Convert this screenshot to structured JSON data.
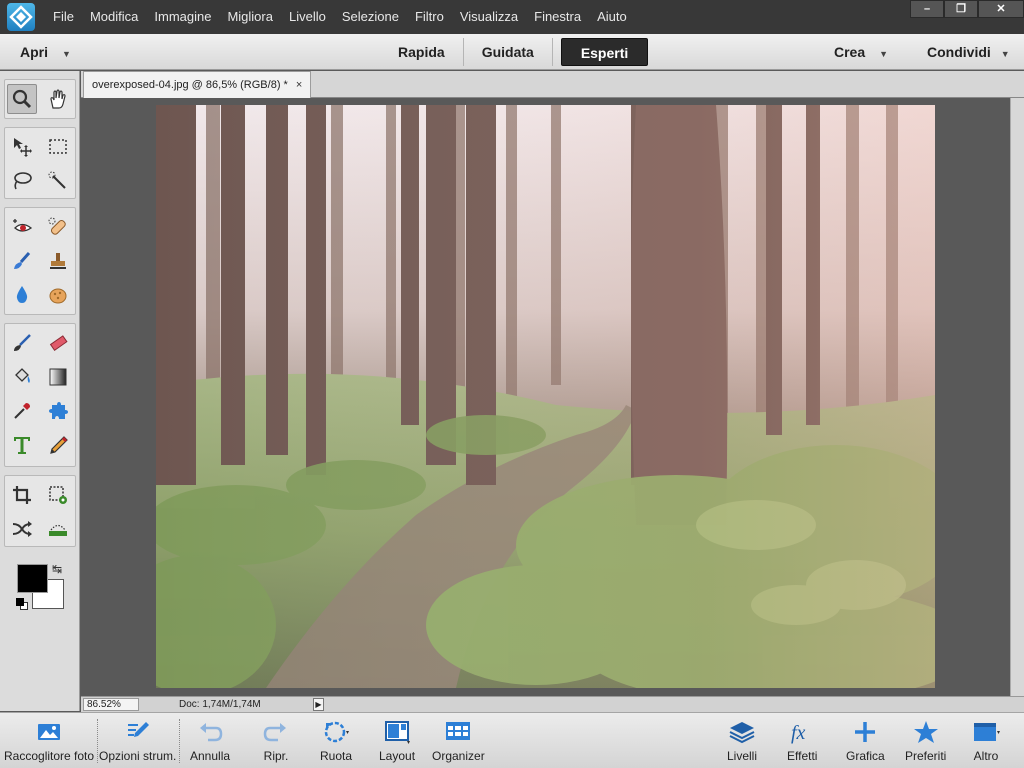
{
  "window": {
    "minimize": "–",
    "restore": "❐",
    "close": "✕"
  },
  "menu": [
    "File",
    "Modifica",
    "Immagine",
    "Migliora",
    "Livello",
    "Selezione",
    "Filtro",
    "Visualizza",
    "Finestra",
    "Aiuto"
  ],
  "modebar": {
    "open": "Apri",
    "modes": [
      "Rapida",
      "Guidata",
      "Esperti"
    ],
    "active_mode": "Esperti",
    "create": "Crea",
    "share": "Condividi"
  },
  "document": {
    "tab_title": "overexposed-04.jpg @ 86,5% (RGB/8) *",
    "close": "×"
  },
  "status": {
    "zoom": "86.52%",
    "doc_info": "Doc: 1,74M/1,74M"
  },
  "taskbar": {
    "left": [
      {
        "label": "Raccoglitore foto",
        "icon": "photo-bin-icon"
      },
      {
        "label": "Opzioni strum.",
        "icon": "tool-options-icon"
      },
      {
        "label": "Annulla",
        "icon": "undo-icon"
      },
      {
        "label": "Ripr.",
        "icon": "redo-icon"
      },
      {
        "label": "Ruota",
        "icon": "rotate-icon"
      },
      {
        "label": "Layout",
        "icon": "layout-icon"
      },
      {
        "label": "Organizer",
        "icon": "organizer-icon"
      }
    ],
    "right": [
      {
        "label": "Livelli",
        "icon": "layers-icon"
      },
      {
        "label": "Effetti",
        "icon": "effects-icon"
      },
      {
        "label": "Grafica",
        "icon": "graphics-icon"
      },
      {
        "label": "Preferiti",
        "icon": "favorites-icon"
      },
      {
        "label": "Altro",
        "icon": "more-icon"
      }
    ]
  },
  "colors": {
    "foreground": "#000000",
    "background": "#ffffff",
    "accent": "#1f7fc0"
  }
}
